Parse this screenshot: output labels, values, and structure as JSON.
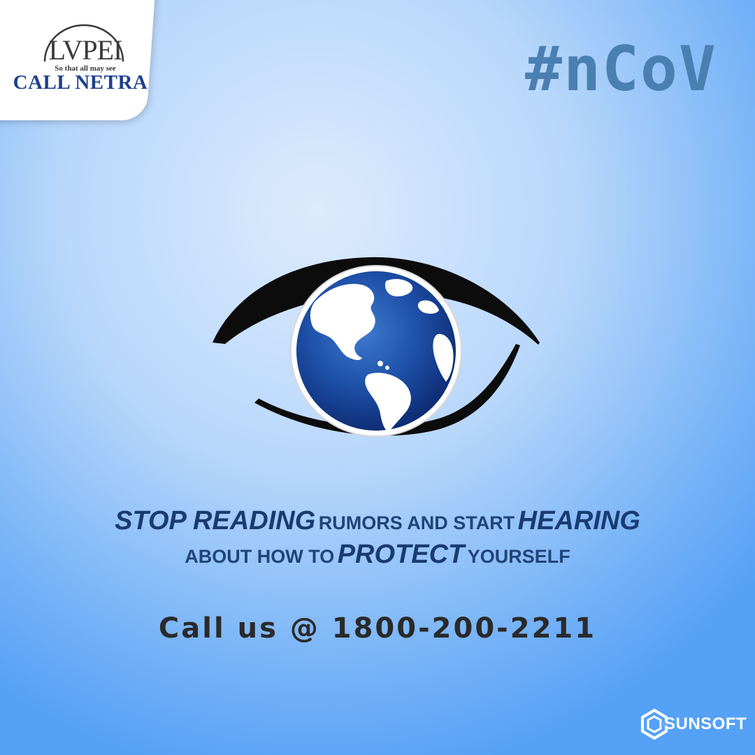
{
  "logo": {
    "mark": "LVPEI",
    "tagline": "So that all may see",
    "name": "CALL NETRA"
  },
  "hashtag": "#nCoV",
  "message": {
    "line1": [
      {
        "text": "STOP READING",
        "emphasis": true
      },
      {
        "text": "RUMORS AND START",
        "emphasis": false
      },
      {
        "text": "HEARING",
        "emphasis": true
      }
    ],
    "line2": [
      {
        "text": "ABOUT HOW TO",
        "emphasis": false
      },
      {
        "text": "PROTECT",
        "emphasis": true
      },
      {
        "text": "YOURSELF",
        "emphasis": false
      }
    ]
  },
  "cta": "Call us @ 1800-200-2211",
  "brand": {
    "name": "SUNSOFT",
    "icon": "sunsoft-hex-logo-icon"
  },
  "illustration": {
    "icon": "eye-with-globe-icon",
    "colors": {
      "eyeline": "#0c0c0c",
      "globe_dark": "#0f2f7e",
      "globe_light": "#2f6cc8",
      "land": "#ffffff"
    }
  },
  "colors": {
    "background_center": "#dcebfd",
    "background_edge": "#55a1f5",
    "hashtag": "#4a7fb1",
    "message": "#14386e",
    "cta": "#2a2a2a",
    "logo_name": "#1d3f8f"
  }
}
